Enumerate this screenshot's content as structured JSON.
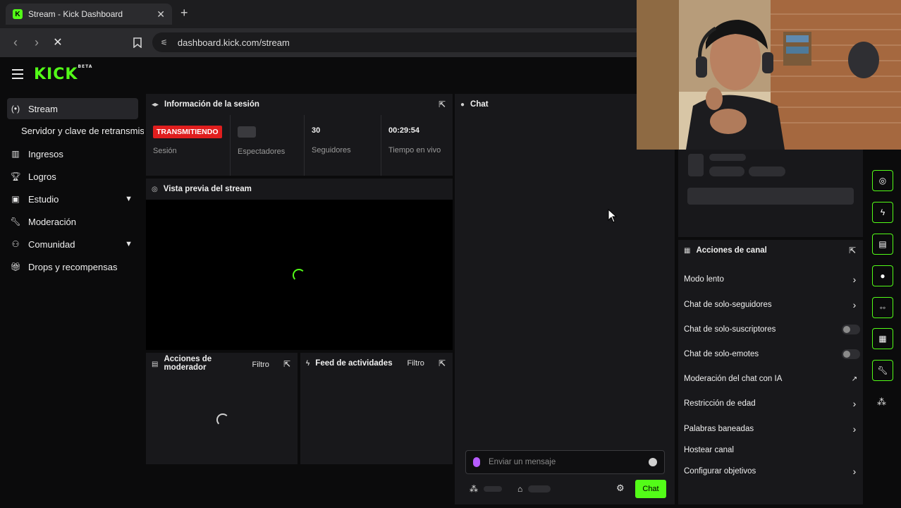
{
  "browser": {
    "tab_title": "Stream - Kick Dashboard",
    "tab_close": "✕",
    "new_tab": "+",
    "url": "dashboard.kick.com/stream"
  },
  "app": {
    "logo": "KICK",
    "logo_badge": "BETA"
  },
  "sidebar": {
    "items": [
      {
        "label": "Stream"
      },
      {
        "label": "Servidor y clave de retransmisión"
      },
      {
        "label": "Ingresos"
      },
      {
        "label": "Logros"
      },
      {
        "label": "Estudio"
      },
      {
        "label": "Moderación"
      },
      {
        "label": "Comunidad"
      },
      {
        "label": "Drops y recompensas"
      }
    ]
  },
  "session": {
    "title": "Información de la sesión",
    "status_badge": "TRANSMITIENDO",
    "status_label": "Sesión",
    "viewers_label": "Espectadores",
    "followers_value": "30",
    "followers_label": "Seguidores",
    "time_value": "00:29:54",
    "time_label": "Tiempo en vivo"
  },
  "preview": {
    "title": "Vista previa del stream"
  },
  "mod_actions": {
    "title": "Acciones de moderador",
    "filter": "Filtro"
  },
  "activity": {
    "title": "Feed de actividades",
    "filter": "Filtro"
  },
  "chat": {
    "title": "Chat",
    "placeholder": "Enviar un mensaje",
    "send_label": "Chat"
  },
  "channel_actions": {
    "title": "Acciones de canal",
    "rows": [
      {
        "label": "Modo lento"
      },
      {
        "label": "Chat de solo-seguidores"
      },
      {
        "label": "Chat de solo-suscriptores"
      },
      {
        "label": "Chat de solo-emotes"
      },
      {
        "label": "Moderación del chat con IA"
      },
      {
        "label": "Restricción de edad"
      },
      {
        "label": "Palabras baneadas"
      },
      {
        "label": "Hostear canal"
      },
      {
        "label": "Configurar objetivos"
      }
    ]
  },
  "colors": {
    "accent": "#53fc18",
    "live": "#e01e1e",
    "panel": "#18181b",
    "bg": "#0b0b0c"
  }
}
